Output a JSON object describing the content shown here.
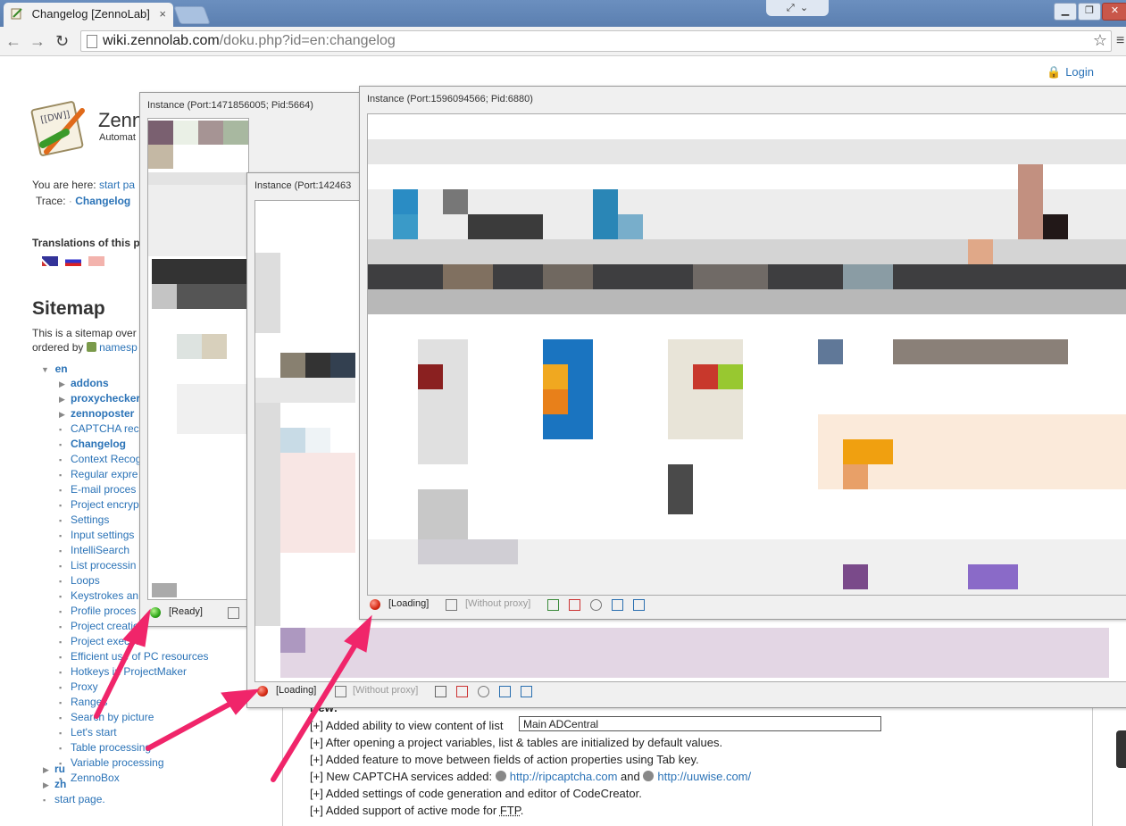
{
  "browser": {
    "tab_title": "Changelog [ZennoLab]",
    "tab_close": "×",
    "url_domain": "wiki.zennolab.com",
    "url_path": "/doku.php?id=en:changelog"
  },
  "page": {
    "login": "Login",
    "site_title_partial": "Zenno",
    "site_subtitle_partial": "Automat",
    "you_are_here_label": "You are here:",
    "you_are_here_link": "start pa",
    "trace_label": "Trace:",
    "trace_link": "Changelog",
    "translations_label": "Translations of this p",
    "sitemap_title": "Sitemap",
    "sitemap_desc_1": "This is a sitemap over",
    "sitemap_desc_2": "ordered by",
    "sitemap_desc_link": "namesp",
    "tree_root": "en",
    "tree_items": [
      {
        "label": "addons",
        "bold": true,
        "folder": true
      },
      {
        "label": "proxychecker",
        "bold": true,
        "folder": true
      },
      {
        "label": "zennoposter",
        "bold": true,
        "folder": true
      },
      {
        "label": "CAPTCHA reco",
        "bold": false,
        "folder": false
      },
      {
        "label": "Changelog",
        "bold": true,
        "folder": false
      },
      {
        "label": "Context Recog",
        "bold": false,
        "folder": false
      },
      {
        "label": "Regular expre",
        "bold": false,
        "folder": false
      },
      {
        "label": "E-mail proces",
        "bold": false,
        "folder": false
      },
      {
        "label": "Project encryp",
        "bold": false,
        "folder": false
      },
      {
        "label": "Settings",
        "bold": false,
        "folder": false
      },
      {
        "label": "Input settings",
        "bold": false,
        "folder": false
      },
      {
        "label": "IntelliSearch",
        "bold": false,
        "folder": false
      },
      {
        "label": "List processin",
        "bold": false,
        "folder": false
      },
      {
        "label": "Loops",
        "bold": false,
        "folder": false
      },
      {
        "label": "Keystrokes an",
        "bold": false,
        "folder": false
      },
      {
        "label": "Profile proces",
        "bold": false,
        "folder": false
      },
      {
        "label": "Project creatio",
        "bold": false,
        "folder": false
      },
      {
        "label": "Project executi",
        "bold": false,
        "folder": false
      },
      {
        "label": "Efficient use of PC resources",
        "bold": false,
        "folder": false
      },
      {
        "label": "Hotkeys in ProjectMaker",
        "bold": false,
        "folder": false
      },
      {
        "label": "Proxy",
        "bold": false,
        "folder": false
      },
      {
        "label": "Ranges",
        "bold": false,
        "folder": false
      },
      {
        "label": "Search by picture",
        "bold": false,
        "folder": false
      },
      {
        "label": "Let's start",
        "bold": false,
        "folder": false
      },
      {
        "label": "Table processing",
        "bold": false,
        "folder": false
      },
      {
        "label": "Variable processing",
        "bold": false,
        "folder": false
      },
      {
        "label": "ZennoBox",
        "bold": false,
        "folder": false
      }
    ],
    "tree_tail": [
      {
        "label": "ru",
        "folder": true
      },
      {
        "label": "zh",
        "folder": true
      },
      {
        "label": "start page.",
        "folder": false
      }
    ]
  },
  "instances": [
    {
      "title": "Instance (Port:1471856005; Pid:5664)",
      "status": "[Ready]"
    },
    {
      "title": "Instance (Port:142463",
      "status": "[Loading]",
      "proxy": "[Without proxy]"
    },
    {
      "title": "Instance (Port:1596094566; Pid:6880)",
      "status": "[Loading]",
      "proxy": "[Without proxy]"
    }
  ],
  "changelog": {
    "heading_partial": "New:",
    "items": [
      {
        "text": "[+] Added ability to view content of list"
      },
      {
        "text": "[+] After opening a project variables, list & tables are initialized by default values."
      },
      {
        "text": "[+] Added feature to move between fields of action properties using Tab key."
      },
      {
        "text": "[+] New CAPTCHA services added:",
        "link1": "http://ripcaptcha.com",
        "mid": "and",
        "link2": "http://uuwise.com/"
      },
      {
        "text": "[+] Added settings of code generation and editor of CodeCreator."
      },
      {
        "text": "[+] Added support of active mode for",
        "link1": "FTP",
        "tail": "."
      }
    ]
  },
  "tooltip": "Main ADCentral",
  "colors": {
    "accent": "#2b73b7",
    "arrow": "#f0256a"
  }
}
